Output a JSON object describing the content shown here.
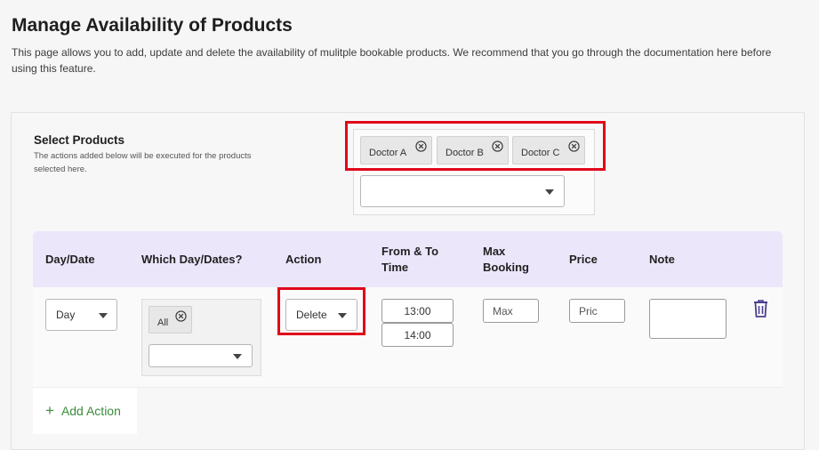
{
  "page": {
    "title": "Manage Availability of Products",
    "description": "This page allows you to add, update and delete the availability of mulitple bookable products. We recommend that you go through the documentation here before using this feature."
  },
  "select_products": {
    "title": "Select Products",
    "help": "The actions added below will be executed for the products selected here.",
    "chips": [
      "Doctor A",
      "Doctor B",
      "Doctor C"
    ],
    "dropdown_value": ""
  },
  "table": {
    "headers": {
      "day_date": "Day/Date",
      "which_days": "Which Day/Dates?",
      "action": "Action",
      "from_to_line1": "From & To",
      "from_to_line2": "Time",
      "max_line1": "Max",
      "max_line2": "Booking",
      "price": "Price",
      "note": "Note"
    },
    "row": {
      "day_date_value": "Day",
      "which_days_chip": "All",
      "which_days_dropdown_value": "",
      "action_value": "Delete",
      "from_time": "13:00",
      "to_time": "14:00",
      "max_booking_placeholder": "Max",
      "price_placeholder": "Pric",
      "note_value": ""
    }
  },
  "add_action_label": "Add Action",
  "colors": {
    "header_bg": "#ebe6fa",
    "highlight": "#e0061a",
    "add_action": "#3a8c3a",
    "trash": "#4a3f8f"
  }
}
